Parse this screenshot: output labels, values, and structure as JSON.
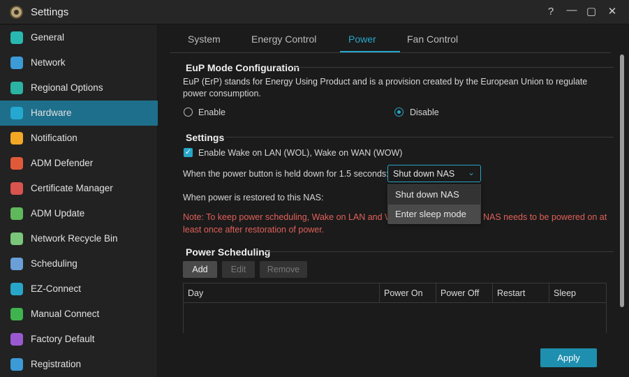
{
  "window": {
    "title": "Settings",
    "controls": [
      "?",
      "—",
      "▢",
      "✕"
    ]
  },
  "sidebar": {
    "items": [
      {
        "label": "General",
        "icon": "general-icon",
        "color": "#29b8b0"
      },
      {
        "label": "Network",
        "icon": "globe-icon",
        "color": "#3c9ad6"
      },
      {
        "label": "Regional Options",
        "icon": "location-icon",
        "color": "#2bb3a3"
      },
      {
        "label": "Hardware",
        "icon": "hardware-icon",
        "color": "#25a8d0"
      },
      {
        "label": "Notification",
        "icon": "notification-icon",
        "color": "#f2a825"
      },
      {
        "label": "ADM Defender",
        "icon": "firewall-icon",
        "color": "#e05a3a"
      },
      {
        "label": "Certificate Manager",
        "icon": "certificate-icon",
        "color": "#d9534f"
      },
      {
        "label": "ADM Update",
        "icon": "update-icon",
        "color": "#5fb85c"
      },
      {
        "label": "Network Recycle Bin",
        "icon": "recycle-bin-icon",
        "color": "#7ac67a"
      },
      {
        "label": "Scheduling",
        "icon": "calendar-icon",
        "color": "#6a9fd8"
      },
      {
        "label": "EZ-Connect",
        "icon": "cloud-icon",
        "color": "#27a6c9"
      },
      {
        "label": "Manual Connect",
        "icon": "manual-connect-icon",
        "color": "#3fb34f"
      },
      {
        "label": "Factory Default",
        "icon": "undo-icon",
        "color": "#9b59d0"
      },
      {
        "label": "Registration",
        "icon": "registration-icon",
        "color": "#3c9ad6"
      }
    ],
    "active_index": 3
  },
  "tabs": [
    "System",
    "Energy Control",
    "Power",
    "Fan Control"
  ],
  "active_tab": "Power",
  "eup": {
    "title": "EuP Mode Configuration",
    "description": "EuP (ErP) stands for Energy Using Product and is a provision created by the European Union to regulate power consumption.",
    "enable_label": "Enable",
    "disable_label": "Disable",
    "selected": "Disable"
  },
  "settings": {
    "title": "Settings",
    "wol_label": "Enable Wake on LAN (WOL), Wake on WAN (WOW)",
    "wol_checked": true,
    "power_button_label": "When the power button is held down for 1.5 seconds:",
    "power_button_value": "Shut down NAS",
    "power_button_options": [
      "Shut down NAS",
      "Enter sleep mode"
    ],
    "restore_label": "When power is restored to this NAS:",
    "note_line1": "Note: To keep power scheduling, Wake on LAN and Wake",
    "note_line1_right": "NAS needs to be powered on at",
    "note_line2": "least once after restoration of power."
  },
  "scheduling": {
    "title": "Power Scheduling",
    "add_label": "Add",
    "edit_label": "Edit",
    "remove_label": "Remove",
    "columns": [
      "Day",
      "Power On",
      "Power Off",
      "Restart",
      "Sleep"
    ]
  },
  "apply_label": "Apply",
  "colors": {
    "accent": "#27a6c9",
    "active_sidebar": "#1e6f8b",
    "note": "#e0605a",
    "apply": "#1e8fae"
  }
}
